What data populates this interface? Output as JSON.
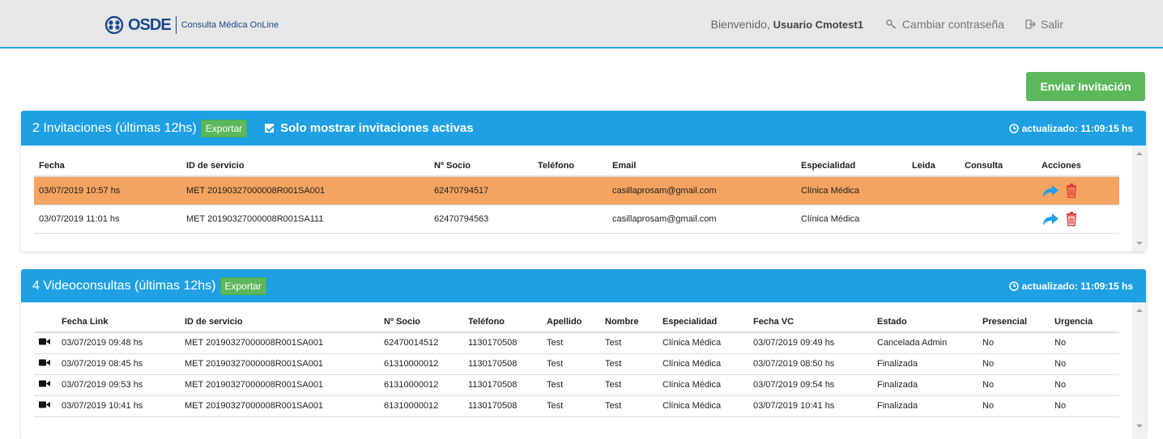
{
  "header": {
    "logo_text": "OSDE",
    "logo_sub": "Consulta Médica OnLine",
    "welcome_prefix": "Bienvenido,",
    "user_name": "Usuario Cmotest1",
    "change_password": "Cambiar contraseña",
    "logout": "Salir"
  },
  "actions": {
    "send_invite": "Enviar Invitación"
  },
  "invitations": {
    "title": "2 Invitaciones (últimas 12hs)",
    "export": "Exportar",
    "only_active": "Solo mostrar invitaciones activas",
    "updated": "actualizado: 11:09:15 hs",
    "columns": [
      "Fecha",
      "ID de servicio",
      "Nº Socio",
      "Teléfono",
      "Email",
      "Especialidad",
      "Leida",
      "Consulta",
      "Acciones"
    ],
    "rows": [
      {
        "fecha": "03/07/2019 10:57 hs",
        "id": "MET 20190327000008R001SA001",
        "socio": "62470794517",
        "telefono": "",
        "email": "casillaprosam@gmail.com",
        "especialidad": "Clínica Médica",
        "leida": "",
        "consulta": ""
      },
      {
        "fecha": "03/07/2019 11:01 hs",
        "id": "MET 20190327000008R001SA111",
        "socio": "62470794563",
        "telefono": "",
        "email": "casillaprosam@gmail.com",
        "especialidad": "Clínica Médica",
        "leida": "",
        "consulta": ""
      }
    ]
  },
  "videoconsultas": {
    "title": "4 Videoconsultas (últimas 12hs)",
    "export": "Exportar",
    "updated": "actualizado: 11:09:15 hs",
    "columns": [
      "Fecha Link",
      "ID de servicio",
      "Nº Socio",
      "Teléfono",
      "Apellido",
      "Nombre",
      "Especialidad",
      "Fecha VC",
      "Estado",
      "Presencial",
      "Urgencia"
    ],
    "rows": [
      {
        "fecha_link": "03/07/2019 09:48 hs",
        "id": "MET 20190327000008R001SA001",
        "socio": "62470014512",
        "telefono": "1130170508",
        "apellido": "Test",
        "nombre": "Test",
        "especialidad": "Clínica Médica",
        "fecha_vc": "03/07/2019 09:49 hs",
        "estado": "Cancelada Admin",
        "presencial": "No",
        "urgencia": "No"
      },
      {
        "fecha_link": "03/07/2019 08:45 hs",
        "id": "MET 20190327000008R001SA001",
        "socio": "61310000012",
        "telefono": "1130170508",
        "apellido": "Test",
        "nombre": "Test",
        "especialidad": "Clínica Médica",
        "fecha_vc": "03/07/2019 08:50 hs",
        "estado": "Finalizada",
        "presencial": "No",
        "urgencia": "No"
      },
      {
        "fecha_link": "03/07/2019 09:53 hs",
        "id": "MET 20190327000008R001SA001",
        "socio": "61310000012",
        "telefono": "1130170508",
        "apellido": "Test",
        "nombre": "Test",
        "especialidad": "Clínica Médica",
        "fecha_vc": "03/07/2019 09:54 hs",
        "estado": "Finalizada",
        "presencial": "No",
        "urgencia": "No"
      },
      {
        "fecha_link": "03/07/2019 10:41 hs",
        "id": "MET 20190327000008R001SA001",
        "socio": "61310000012",
        "telefono": "1130170508",
        "apellido": "Test",
        "nombre": "Test",
        "especialidad": "Clínica Médica",
        "fecha_vc": "03/07/2019 10:41 hs",
        "estado": "Finalizada",
        "presencial": "No",
        "urgencia": "No"
      }
    ]
  },
  "icons": {
    "logo": "osde-logo-icon",
    "key": "key-icon",
    "logout": "sign-out-icon",
    "clock": "clock-icon",
    "check": "checkbox-checked-icon",
    "forward": "share-arrow-icon",
    "trash": "trash-icon",
    "video": "video-camera-icon"
  },
  "colors": {
    "brand": "#1b4a8c",
    "panel_header": "#1fa0e3",
    "success": "#5cb85c",
    "highlight_row": "#f4a460",
    "forward_icon": "#1fa0e3",
    "trash_icon": "#e0403a"
  }
}
